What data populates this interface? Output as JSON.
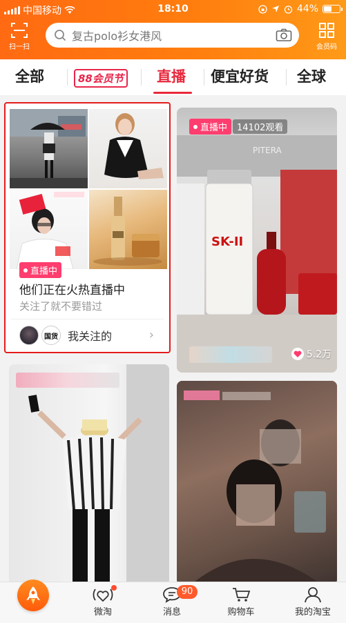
{
  "status_bar": {
    "carrier": "中国移动",
    "time": "18:10",
    "battery": "44%",
    "battery_level": 0.44
  },
  "header": {
    "scan_label": "扫一扫",
    "search_placeholder": "复古polo衫女港风",
    "member_label": "会员码"
  },
  "tabs": [
    {
      "label": "全部"
    },
    {
      "label": "88会员节"
    },
    {
      "label": "直播",
      "active": true
    },
    {
      "label": "便宜好货"
    },
    {
      "label": "全球"
    }
  ],
  "follow_card": {
    "live_label": "直播中",
    "title": "他们正在火热直播中",
    "subtitle": "关注了就不要错过",
    "footer_label": "我关注的",
    "avatar2_text": "国货"
  },
  "live_card_1": {
    "live_label": "直播中",
    "viewers": "14102观看",
    "likes": "5.2万",
    "brand_text": "PITERA",
    "product_text": "SK-II"
  },
  "bottom_nav": {
    "items": [
      {
        "label": "微淘"
      },
      {
        "label": "消息",
        "badge": "90"
      },
      {
        "label": "购物车"
      },
      {
        "label": "我的淘宝"
      }
    ]
  },
  "colors": {
    "accent": "#ff6a12",
    "tab_active": "#e8283c",
    "live": "#ff3d6e",
    "highlight_border": "#e41b1b"
  }
}
